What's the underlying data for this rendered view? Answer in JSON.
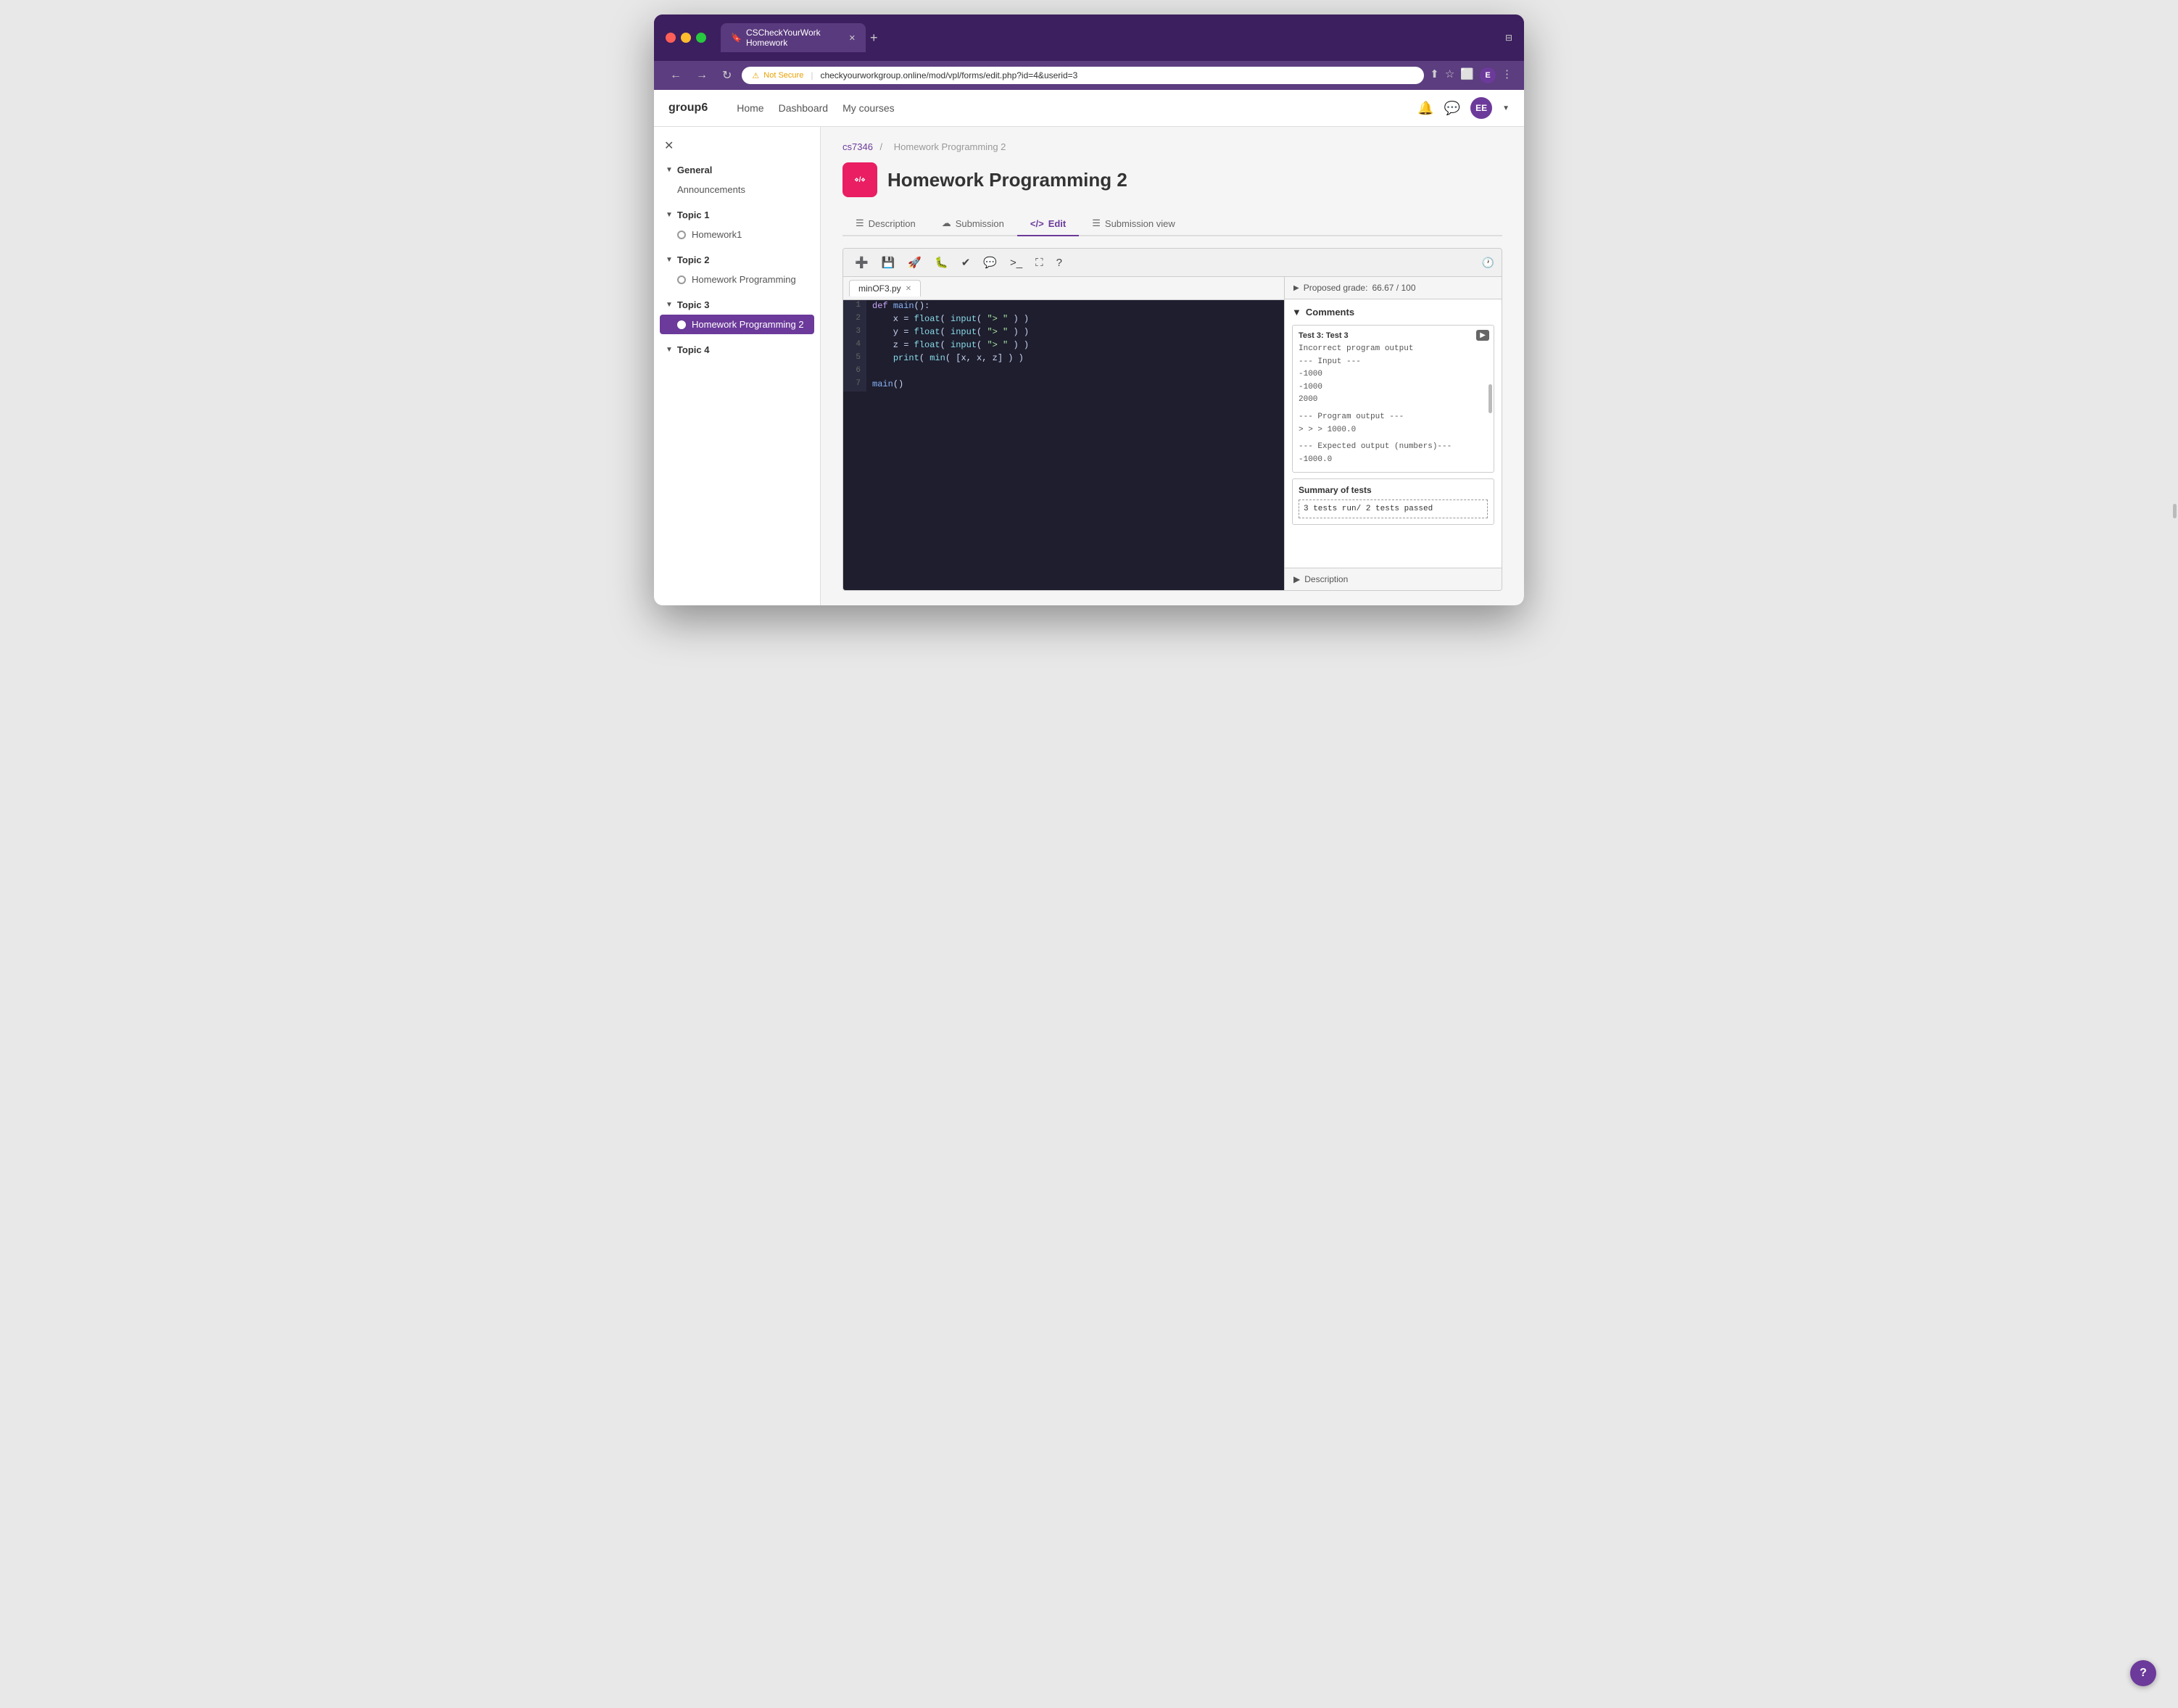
{
  "browser": {
    "tab_title": "CSCheckYourWork Homework",
    "url_security": "Not Secure",
    "url_full": "checkyourworkgroup.online/mod/vpl/forms/edit.php?id=4&userid=3",
    "url_domain": "checkyourworkgroup.online",
    "url_path": "/mod/vpl/forms/edit.php?id=4&userid=3"
  },
  "topnav": {
    "logo": "group6",
    "links": [
      "Home",
      "Dashboard",
      "My courses"
    ],
    "user_initials": "EE"
  },
  "sidebar": {
    "sections": [
      {
        "label": "General",
        "items": [
          "Announcements"
        ]
      },
      {
        "label": "Topic 1",
        "items": [
          "Homework1"
        ]
      },
      {
        "label": "Topic 2",
        "items": [
          "Homework Programming"
        ]
      },
      {
        "label": "Topic 3",
        "items": [
          "Homework Programming 2"
        ],
        "active_item": "Homework Programming 2"
      },
      {
        "label": "Topic 4",
        "items": []
      }
    ]
  },
  "breadcrumb": {
    "course": "cs7346",
    "separator": "/",
    "current": "Homework Programming 2"
  },
  "page": {
    "title": "Homework Programming 2",
    "vpl_label": "VPL"
  },
  "tabs": [
    {
      "label": "Description",
      "icon": "☰",
      "active": false
    },
    {
      "label": "Submission",
      "icon": "☁",
      "active": false
    },
    {
      "label": "Edit",
      "icon": "</>",
      "active": true
    },
    {
      "label": "Submission view",
      "icon": "☰",
      "active": false
    }
  ],
  "editor": {
    "file_tab": "minOF3.py",
    "code_lines": [
      {
        "num": "1",
        "content": "def main():"
      },
      {
        "num": "2",
        "content": "    x = float( input( \"> \" ) )"
      },
      {
        "num": "3",
        "content": "    y = float( input( \"> \" ) )"
      },
      {
        "num": "4",
        "content": "    z = float( input( \"> \" ) )"
      },
      {
        "num": "5",
        "content": "    print( min( [x, x, z] ) )"
      },
      {
        "num": "6",
        "content": ""
      },
      {
        "num": "7",
        "content": "main()"
      }
    ]
  },
  "right_panel": {
    "proposed_grade_label": "Proposed grade:",
    "proposed_grade_value": "66.67 / 100",
    "comments_label": "Comments",
    "test3": {
      "title": "Test 3: Test 3",
      "incorrect_label": "Incorrect program output",
      "input_label": "--- Input ---",
      "input_values": "-1000\n-1000\n2000",
      "program_output_label": "--- Program output ---",
      "program_output_values": "> > > 1000.0",
      "expected_output_label": "--- Expected output (numbers)---",
      "expected_output_values": "-1000.0"
    },
    "summary": {
      "title": "Summary of tests",
      "value": "3 tests run/ 2 tests passed"
    },
    "description_label": "Description"
  },
  "help_btn": "?"
}
